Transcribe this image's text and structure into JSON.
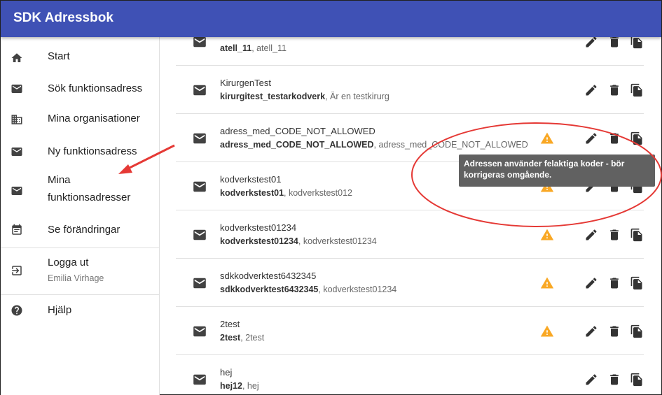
{
  "app": {
    "title": "SDK Adressbok"
  },
  "sidebar": {
    "items": [
      {
        "label": "Start",
        "icon": "home-icon"
      },
      {
        "label": "Sök funktionsadress",
        "icon": "mail-icon"
      },
      {
        "label": "Mina organisationer",
        "icon": "business-icon"
      },
      {
        "label": "Ny funktionsadress",
        "icon": "mail-icon"
      },
      {
        "label_line1": "Mina",
        "label_line2": "funktionsadresser",
        "icon": "mail-icon"
      },
      {
        "label": "Se förändringar",
        "icon": "event-note-icon"
      },
      {
        "label": "Logga ut",
        "sub": "Emilia Virhage",
        "icon": "logout-icon"
      },
      {
        "label": "Hjälp",
        "icon": "help-icon"
      }
    ]
  },
  "list": {
    "rows": [
      {
        "title": "",
        "bold": "atell_11",
        "rest": ", atell_11",
        "warning": false
      },
      {
        "title": "KirurgenTest",
        "bold": "kirurgitest_testarkodverk",
        "rest": ", Är en testkirurg",
        "warning": false
      },
      {
        "title": "adress_med_CODE_NOT_ALLOWED",
        "bold": "adress_med_CODE_NOT_ALLOWED",
        "rest": ", adress_med_CODE_NOT_ALLOWED",
        "warning": true
      },
      {
        "title": "kodverkstest01",
        "bold": "kodverkstest01",
        "rest": ", kodverkstest012",
        "warning": true
      },
      {
        "title": "kodverkstest01234",
        "bold": "kodverkstest01234",
        "rest": ", kodverkstest01234",
        "warning": true
      },
      {
        "title": "sdkkodverktest6432345",
        "bold": "sdkkodverktest6432345",
        "rest": ", kodverkstest01234",
        "warning": true
      },
      {
        "title": "2test",
        "bold": "2test",
        "rest": ", 2test",
        "warning": true
      },
      {
        "title": "hej",
        "bold": "hej12",
        "rest": ", hej",
        "warning": false
      }
    ]
  },
  "tooltip": {
    "line1": "Adressen använder felaktiga koder - bör",
    "line2": "korrigeras omgående."
  },
  "colors": {
    "appbar": "#3F51B5",
    "warning": "#F9A825",
    "annotation": "#E53935",
    "icon": "#333333"
  }
}
